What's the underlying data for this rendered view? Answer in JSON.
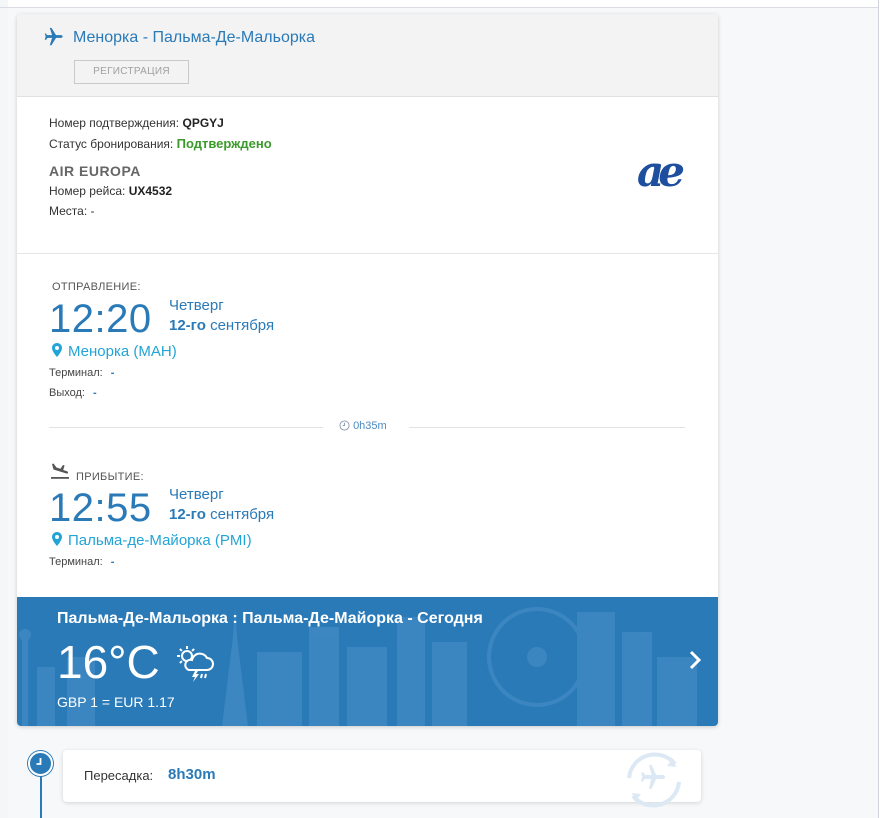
{
  "flight": {
    "route_title": "Менорка - Пальма-Де-Мальорка",
    "registration_label": "РЕГИСТРАЦИЯ"
  },
  "booking": {
    "confirmation_label": "Номер подтверждения:",
    "confirmation_value": "QPGYJ",
    "status_label": "Статус бронирования:",
    "status_value": "Подтверждено",
    "airline_name": "AIR EUROPA",
    "flight_number_label": "Номер рейса:",
    "flight_number_value": "UX4532",
    "seats_label": "Места:",
    "seats_value": "-",
    "airline_logo_text": "ae"
  },
  "departure": {
    "label": "ОТПРАВЛЕНИЕ:",
    "time": "12:20",
    "weekday": "Четверг",
    "date_bold": "12-го",
    "date_rest": " сентября",
    "place": "Менорка (MAH)",
    "terminal_label": "Терминал:",
    "terminal_value": "-",
    "gate_label": "Выход:",
    "gate_value": "-"
  },
  "duration": "0h35m",
  "arrival": {
    "label": "ПРИБЫТИЕ:",
    "time": "12:55",
    "weekday": "Четверг",
    "date_bold": "12-го",
    "date_rest": " сентября",
    "place": "Пальма-де-Майорка (PMI)",
    "terminal_label": "Терминал:",
    "terminal_value": "-"
  },
  "weather": {
    "title": "Пальма-Де-Мальорка : Пальма-Де-Майорка - Сегодня",
    "temperature": "16°C",
    "exchange_rate": "GBP 1 = EUR 1.17",
    "icon": "storm-cloud-icon"
  },
  "layover": {
    "label": "Пересадка:",
    "value": "8h30m"
  },
  "colors": {
    "accent": "#2a7ab8",
    "status_ok": "#3a9a2a",
    "place_link": "#22a4d6"
  }
}
